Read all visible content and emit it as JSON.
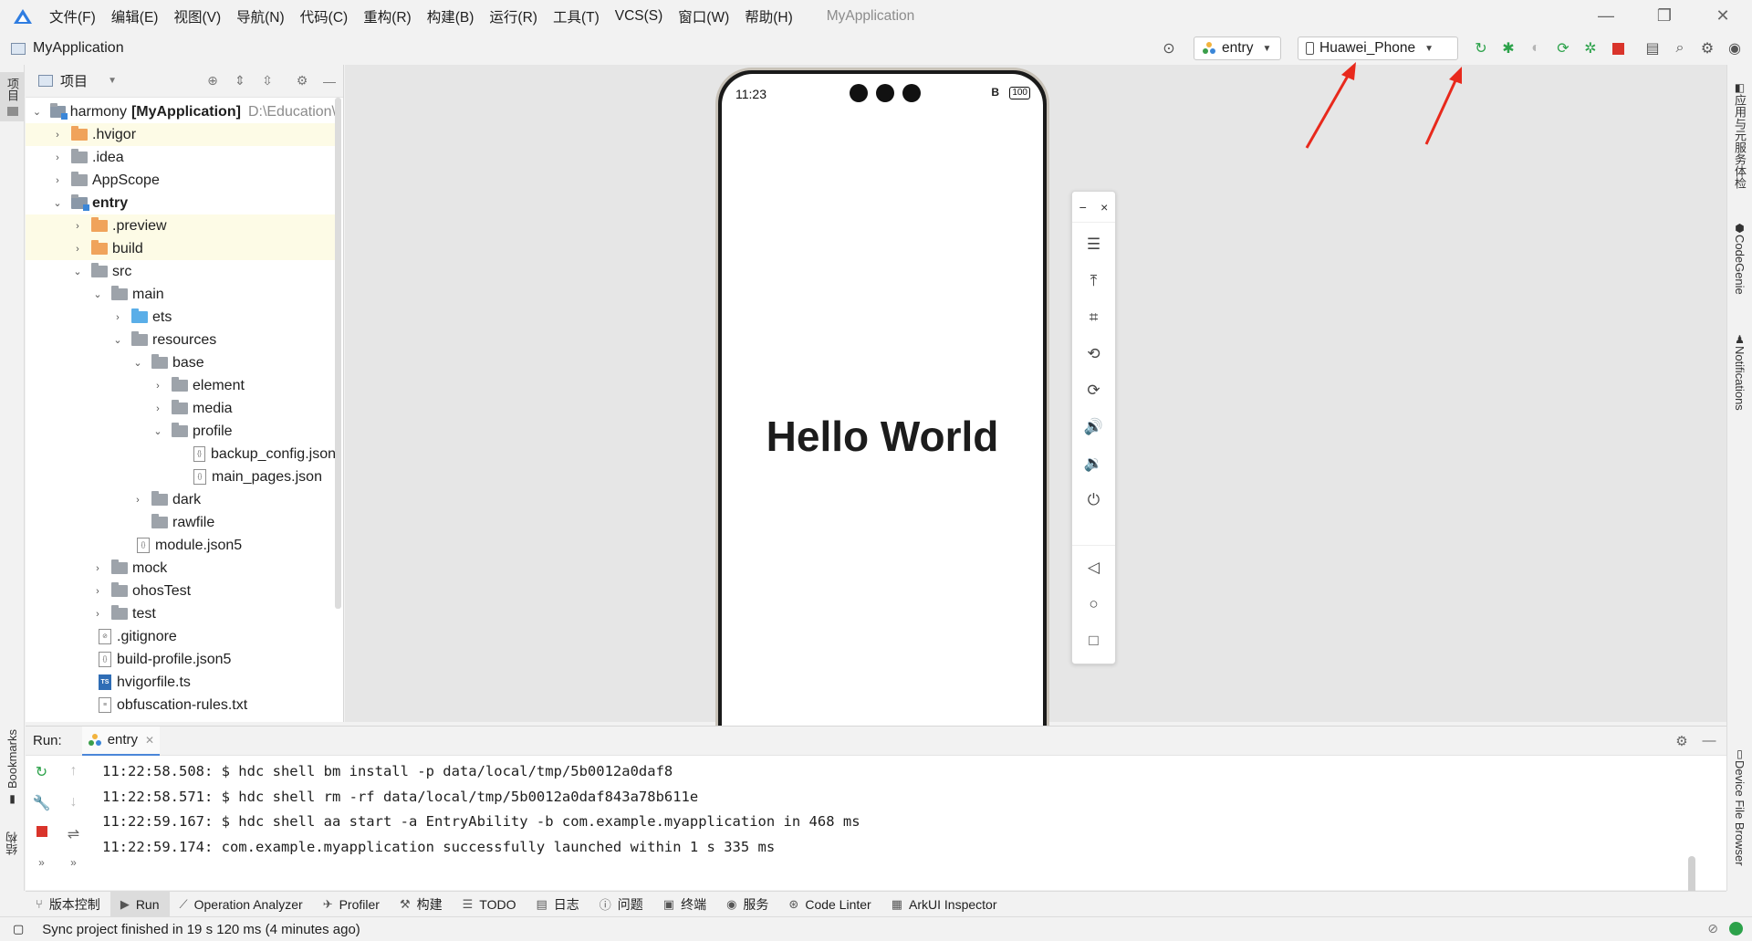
{
  "menubar": {
    "items": [
      "文件(F)",
      "编辑(E)",
      "视图(V)",
      "导航(N)",
      "代码(C)",
      "重构(R)",
      "构建(B)",
      "运行(R)",
      "工具(T)",
      "VCS(S)",
      "窗口(W)",
      "帮助(H)"
    ],
    "window_title": "MyApplication"
  },
  "toolbar": {
    "project_name": "MyApplication",
    "module_select": "entry",
    "device_select": "Huawei_Phone"
  },
  "left_strip": {
    "project_tab": "项目",
    "bookmarks_tab": "Bookmarks",
    "structure_tab": "结构"
  },
  "right_strip": {
    "app_service_tab": "应用与元服务体检",
    "codegenie_tab": "CodeGenie",
    "notifications_tab": "Notifications",
    "device_file_tab": "Device File Browser"
  },
  "project_panel": {
    "title": "项目",
    "root_name": "harmony",
    "root_module": "[MyApplication]",
    "root_path": "D:\\Education\\",
    "items": [
      {
        "label": ".hvigor"
      },
      {
        "label": ".idea"
      },
      {
        "label": "AppScope"
      },
      {
        "label": "entry"
      },
      {
        "label": ".preview"
      },
      {
        "label": "build"
      },
      {
        "label": "src"
      },
      {
        "label": "main"
      },
      {
        "label": "ets"
      },
      {
        "label": "resources"
      },
      {
        "label": "base"
      },
      {
        "label": "element"
      },
      {
        "label": "media"
      },
      {
        "label": "profile"
      },
      {
        "label": "backup_config.json"
      },
      {
        "label": "main_pages.json"
      },
      {
        "label": "dark"
      },
      {
        "label": "rawfile"
      },
      {
        "label": "module.json5"
      },
      {
        "label": "mock"
      },
      {
        "label": "ohosTest"
      },
      {
        "label": "test"
      },
      {
        "label": ".gitignore"
      },
      {
        "label": "build-profile.json5"
      },
      {
        "label": "hvigorfile.ts"
      },
      {
        "label": "obfuscation-rules.txt"
      }
    ]
  },
  "phone": {
    "time": "11:23",
    "battery": "100",
    "battery_prefix": "B",
    "content_text": "Hello World"
  },
  "emulator_toolbar": {
    "minimize": "−",
    "close": "×"
  },
  "run_panel": {
    "label": "Run:",
    "tab": "entry",
    "lines": [
      "11:22:58.508: $ hdc shell bm install -p data/local/tmp/5b0012a0daf8",
      "11:22:58.571: $ hdc shell rm -rf data/local/tmp/5b0012a0daf843a78b611e",
      "11:22:59.167: $ hdc shell aa start -a EntryAbility -b com.example.myapplication in 468 ms",
      "11:22:59.174: com.example.myapplication successfully launched within 1 s 335 ms"
    ]
  },
  "bottom_tabs": [
    "版本控制",
    "Run",
    "Operation Analyzer",
    "Profiler",
    "构建",
    "TODO",
    "日志",
    "问题",
    "终端",
    "服务",
    "Code Linter",
    "ArkUI Inspector"
  ],
  "status": {
    "message": "Sync project finished in 19 s 120 ms (4 minutes ago)"
  },
  "colors": {
    "accent": "#4a86d8",
    "arrow": "#e8291c",
    "run_green": "#2ca24a",
    "stop_red": "#d9342b"
  }
}
